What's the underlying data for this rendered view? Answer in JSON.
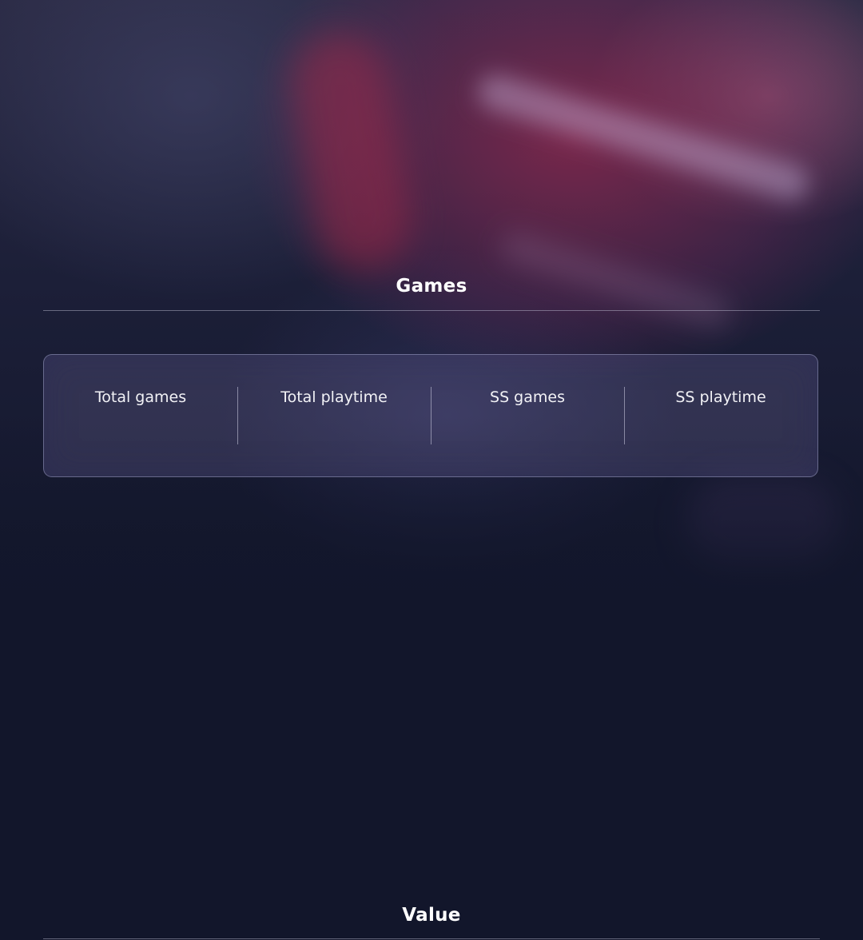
{
  "sections": {
    "games": {
      "title": "Games",
      "stats": [
        {
          "label": "Total games",
          "value": ""
        },
        {
          "label": "Total playtime",
          "value": ""
        },
        {
          "label": "SS games",
          "value": ""
        },
        {
          "label": "SS playtime",
          "value": ""
        }
      ]
    },
    "value": {
      "title": "Value"
    }
  },
  "colors": {
    "background": "#12162b",
    "card_border": "#aaafd7",
    "text": "#ffffff"
  }
}
